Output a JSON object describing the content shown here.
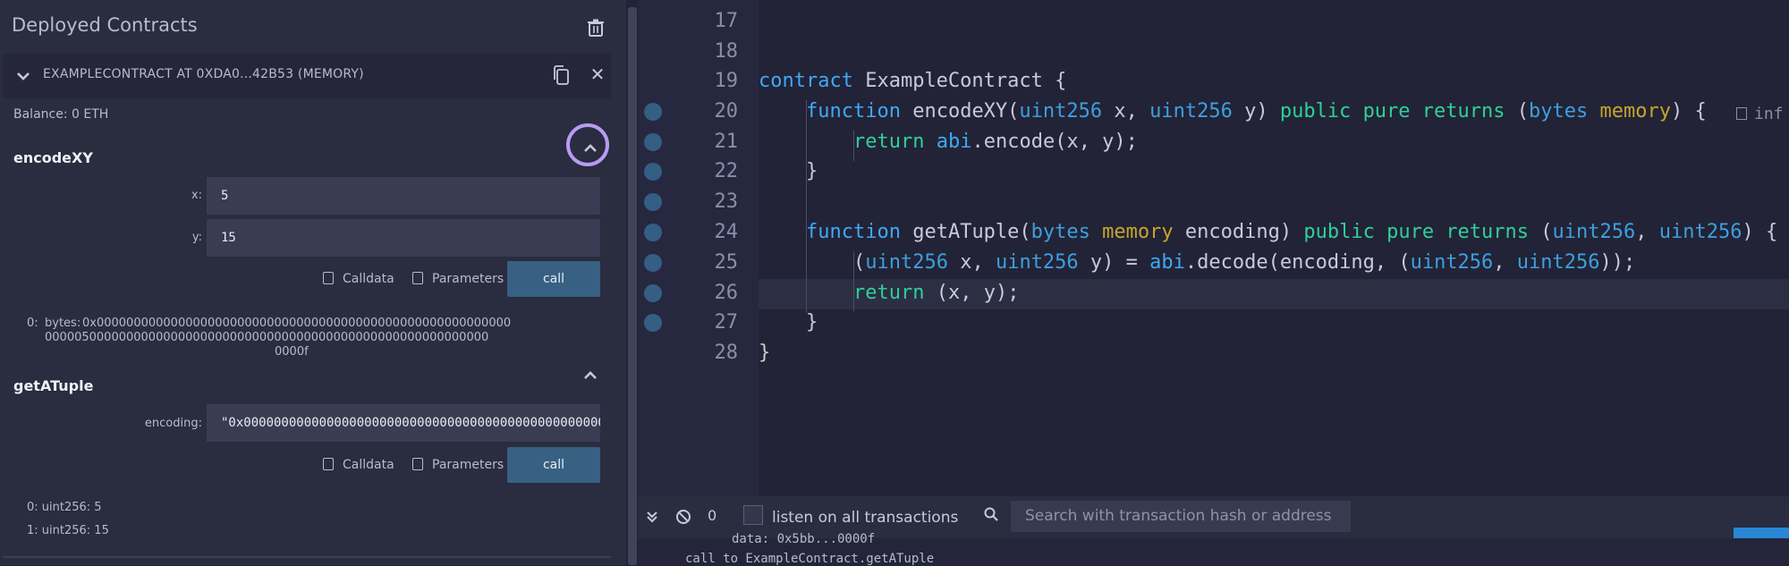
{
  "left_panel": {
    "title": "Deployed Contracts",
    "instance": {
      "label": "EXAMPLECONTRACT AT 0XDA0...42B53 (MEMORY)"
    },
    "balance": "Balance: 0 ETH",
    "functions": [
      {
        "name": "encodeXY",
        "params": [
          {
            "label": "x:",
            "value": "5"
          },
          {
            "label": "y:",
            "value": "15"
          }
        ],
        "calldata_label": "Calldata",
        "parameters_label": "Parameters",
        "call_label": "call",
        "result_index": "0:",
        "result_type": "bytes:",
        "result_value_line1": "0x00000000000000000000000000000000000000000000000000000000",
        "result_value_line2": "000005000000000000000000000000000000000000000000000000000000",
        "result_value_line3": "0000f"
      },
      {
        "name": "getATuple",
        "params": [
          {
            "label": "encoding:",
            "value": "\"0x0000000000000000000000000000000000000000000000000"
          }
        ],
        "calldata_label": "Calldata",
        "parameters_label": "Parameters",
        "call_label": "call",
        "results": [
          "0: uint256: 5",
          "1: uint256: 15"
        ]
      }
    ]
  },
  "editor": {
    "line_numbers": [
      "17",
      "18",
      "19",
      "20",
      "21",
      "22",
      "23",
      "24",
      "25",
      "26",
      "27",
      "28"
    ],
    "lines": {
      "l19": {
        "a": "contract",
        "b": " ExampleContract {"
      },
      "l20": {
        "a": "function",
        "b": " encodeXY(",
        "c": "uint256",
        "d": " x, ",
        "e": "uint256",
        "f": " y) ",
        "g": "public",
        "h": " ",
        "i": "pure",
        "j": " ",
        "k": "returns",
        "l": " (",
        "m": "bytes",
        "n": " ",
        "o": "memory",
        "p": ") {"
      },
      "l21": {
        "a": "return",
        "b": " ",
        "c": "abi",
        "d": ".encode(x, y);"
      },
      "l22": {
        "a": "}"
      },
      "l24": {
        "a": "function",
        "b": " getATuple(",
        "c": "bytes",
        "d": " ",
        "e": "memory",
        "f": " encoding) ",
        "g": "public",
        "h": " ",
        "i": "pure",
        "j": " ",
        "k": "returns",
        "l": " (",
        "m": "uint256",
        "n": ", ",
        "o": "uint256",
        "p": ") {"
      },
      "l25": {
        "a": "(",
        "b": "uint256",
        "c": " x, ",
        "d": "uint256",
        "e": " y) = ",
        "f": "abi",
        "g": ".decode(encoding, (",
        "h": "uint256",
        "i": ", ",
        "j": "uint256",
        "k": "));"
      },
      "l26": {
        "a": "return",
        "b": " (x, y);"
      },
      "l27": {
        "a": "}"
      },
      "l28": {
        "a": "}"
      }
    },
    "gas_hint": "inf"
  },
  "terminal": {
    "pending_count": "0",
    "listen_label": "listen on all transactions",
    "search_placeholder": "Search with transaction hash or address",
    "log_line1": "data: 0x5bb...0000f",
    "log_line2": "call to ExampleContract.getATuple"
  },
  "colors": {
    "panel_bg": "#2a2c3f",
    "editor_bg": "#222336",
    "call_button": "#386082",
    "highlight_ring": "#b79cf3",
    "keyword_blue": "#3fa9f5",
    "keyword_green": "#2fcf9a",
    "memory_yellow": "#c8a42c"
  }
}
